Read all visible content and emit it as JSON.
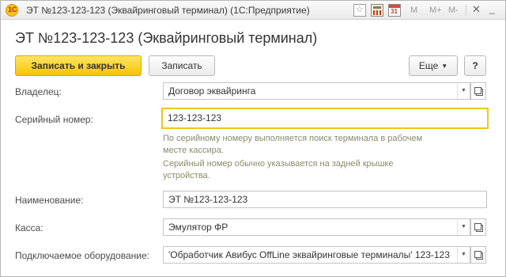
{
  "titlebar": {
    "title": "ЭТ №123-123-123 (Эквайринговый терминал)  (1С:Предприятие)",
    "logo_text": "1С",
    "calendar_day": "31",
    "m_label": "M",
    "m_plus_label": "M+",
    "m_minus_label": "M-",
    "close_glyph": "✕",
    "minimize_glyph": "_"
  },
  "form": {
    "title": "ЭТ №123-123-123 (Эквайринговый терминал)"
  },
  "toolbar": {
    "save_close_label": "Записать и закрыть",
    "save_label": "Записать",
    "more_label": "Еще",
    "help_label": "?"
  },
  "fields": {
    "owner": {
      "label": "Владелец:",
      "value": "Договор эквайринга"
    },
    "serial": {
      "label": "Серийный номер:",
      "value": "123-123-123"
    },
    "serial_hint": [
      "По серийному номеру выполняется поиск терминала в рабочем",
      "месте кассира.",
      "Серийный номер обычно указывается на задней крышке",
      "устройства."
    ],
    "name": {
      "label": "Наименование:",
      "value": "ЭТ №123-123-123"
    },
    "kassa": {
      "label": "Касса:",
      "value": "Эмулятор ФР"
    },
    "equipment": {
      "label": "Подключаемое оборудование:",
      "value": "'Обработчик Авибус OffLine эквайринговые терминалы' 123-123"
    }
  },
  "colors": {
    "accent_yellow": "#f5c400",
    "focus_border": "#f0c419",
    "hint_text": "#8a8a6a"
  },
  "icons": {
    "dropdown": "triangle-down",
    "open": "open-window",
    "favorite": "star",
    "calculator": "calculator",
    "calendar": "calendar"
  }
}
